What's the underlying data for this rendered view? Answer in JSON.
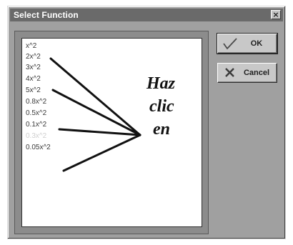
{
  "window": {
    "title": "Select Function",
    "close_symbol": "×"
  },
  "function_list": {
    "items": [
      {
        "label": "x^2",
        "dim": false
      },
      {
        "label": "2x^2",
        "dim": false
      },
      {
        "label": "3x^2",
        "dim": false
      },
      {
        "label": "4x^2",
        "dim": false
      },
      {
        "label": "5x^2",
        "dim": false
      },
      {
        "label": "0.8x^2",
        "dim": false
      },
      {
        "label": "0.5x^2",
        "dim": false
      },
      {
        "label": "0.1x^2",
        "dim": false
      },
      {
        "label": "0.3x^2",
        "dim": true
      },
      {
        "label": "0.05x^2",
        "dim": false
      }
    ]
  },
  "annotation": {
    "line1": "Haz",
    "line2": "clic",
    "line3": "en"
  },
  "buttons": {
    "ok_label": "OK",
    "cancel_label": "Cancel"
  },
  "colors": {
    "dialog_bg": "#a0a0a0",
    "titlebar_bg": "#6a6a6a",
    "list_bg": "#ffffff",
    "dim_item": "#cfcfcf"
  },
  "icons": {
    "ok": "checkmark-icon",
    "cancel": "x-icon",
    "close": "close-icon"
  }
}
